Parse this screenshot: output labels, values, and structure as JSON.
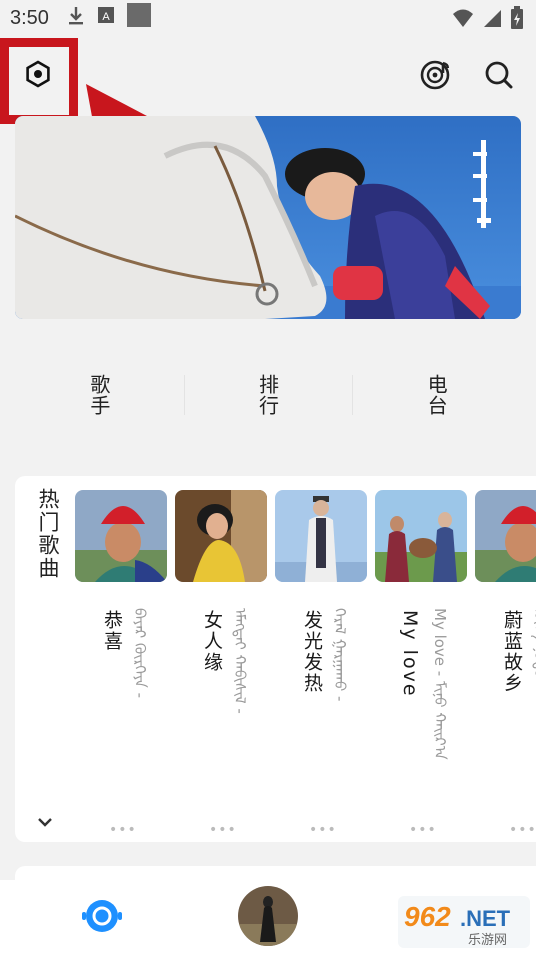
{
  "status_bar": {
    "time": "3:50"
  },
  "header": {
    "settings_icon": "hexagon-settings-icon",
    "music_icon": "music-disc-icon",
    "search_icon": "search-icon"
  },
  "categories": [
    {
      "label": "歌手"
    },
    {
      "label": "排行"
    },
    {
      "label": "电台"
    }
  ],
  "hot_songs": {
    "title": "热门歌曲",
    "items": [
      {
        "title": "恭喜",
        "subtitle": "ᠪᠠᠶᠠᠷ ᠬᠦᠷᠭᠡᠶᠡ -",
        "dots": "•••"
      },
      {
        "title": "女人缘",
        "subtitle": "ᠡᠮᠡᠭᠲᠡᠢ ᠬᠠᠪᠢᠰᠢᠯ -",
        "dots": "•••"
      },
      {
        "title": "发光发热",
        "subtitle": "ᠭᠡᠷᠡᠯ ᠭᠠᠷᠭᠠᠬᠤ -",
        "dots": "•••"
      },
      {
        "title": "My love",
        "subtitle": "My love - ᠮᠢᠨᠤ ᠬᠠᠢᠷ᠎ᠠ",
        "dots": "•••"
      },
      {
        "title": "蔚蓝故乡",
        "subtitle": "ᠬᠥᠬᠡ ᠨᠤᠲᠤᠭ -",
        "dots": "•••"
      }
    ]
  },
  "bottom_nav": {
    "home_icon": "radio-home-icon",
    "player_icon": "now-playing-avatar"
  },
  "watermark": {
    "top": "962",
    "suffix": ".NET",
    "bottom": "乐游网"
  },
  "colors": {
    "accent": "#1e90ff",
    "annotation_red": "#c8161d"
  }
}
